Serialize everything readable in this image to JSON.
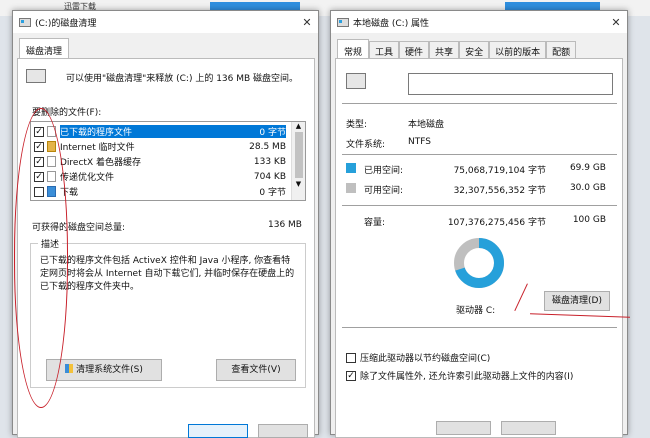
{
  "background": {
    "label": "迅雷下载"
  },
  "cleanup": {
    "title": "(C:)的磁盘清理",
    "tab": "磁盘清理",
    "intro": "可以使用\"磁盘清理\"来释放 (C:) 上的 136 MB 磁盘空间。",
    "files_label": "要删除的文件(F):",
    "files": [
      {
        "name": "已下载的程序文件",
        "size": "0 字节",
        "checked": true,
        "selected": true
      },
      {
        "name": "Internet 临时文件",
        "size": "28.5 MB",
        "checked": true
      },
      {
        "name": "DirectX 着色器缓存",
        "size": "133 KB",
        "checked": true
      },
      {
        "name": "传递优化文件",
        "size": "704 KB",
        "checked": true
      },
      {
        "name": "下载",
        "size": "0 字节",
        "checked": false
      }
    ],
    "total_label": "可获得的磁盘空间总量:",
    "total_value": "136 MB",
    "desc_label": "描述",
    "description": "已下载的程序文件包括 ActiveX 控件和 Java 小程序, 你查看特定网页时将会从 Internet 自动下载它们, 并临时保存在硬盘上的已下载的程序文件夹中。",
    "clean_system_button": "清理系统文件(S)",
    "view_files_button": "查看文件(V)"
  },
  "props": {
    "title": "本地磁盘 (C:) 属性",
    "tabs": [
      "常规",
      "工具",
      "硬件",
      "共享",
      "安全",
      "以前的版本",
      "配额"
    ],
    "type_label": "类型:",
    "type_value": "本地磁盘",
    "fs_label": "文件系统:",
    "fs_value": "NTFS",
    "used_label": "已用空间:",
    "used_bytes": "75,068,719,104 字节",
    "used_gb": "69.9 GB",
    "free_label": "可用空间:",
    "free_bytes": "32,307,556,352 字节",
    "free_gb": "30.0 GB",
    "cap_label": "容量:",
    "cap_bytes": "107,376,275,456 字节",
    "cap_gb": "100 GB",
    "drive_label": "驱动器 C:",
    "cleanup_button": "磁盘清理(D)",
    "compress_label": "压缩此驱动器以节约磁盘空间(C)",
    "index_label": "除了文件属性外, 还允许索引此驱动器上文件的内容(I)",
    "used_fraction": 0.699,
    "colors": {
      "used": "#26a0da",
      "free": "#bfbfbf"
    }
  }
}
